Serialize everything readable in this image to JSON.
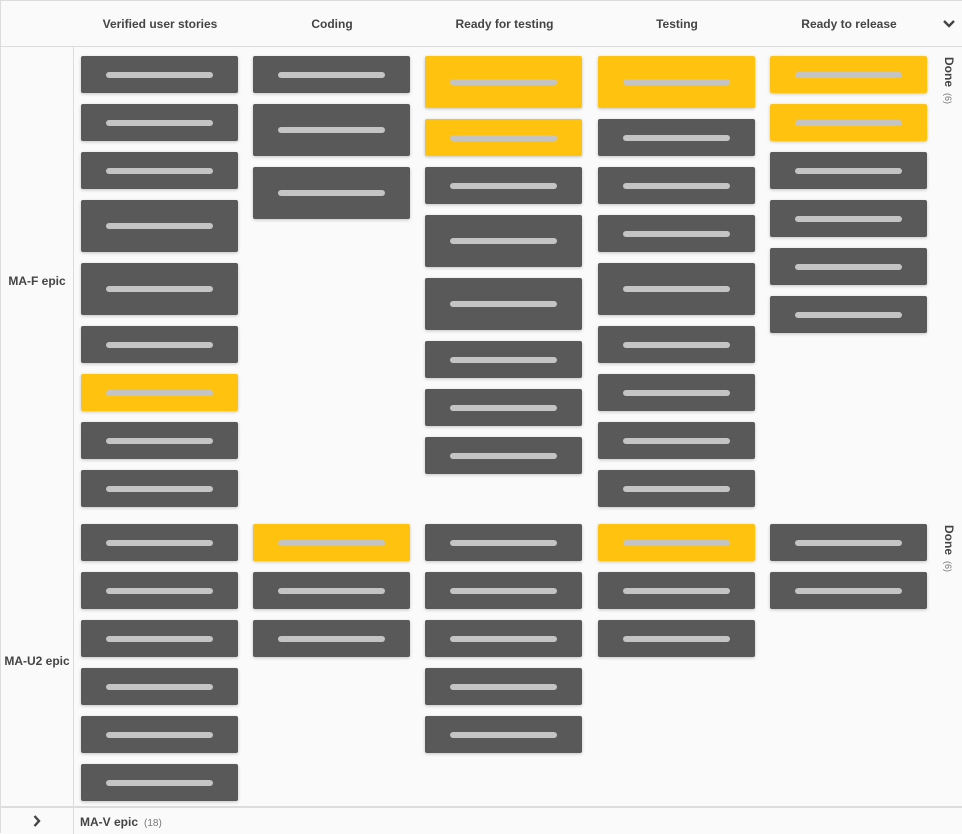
{
  "colors": {
    "card_default": "#595959",
    "card_highlight": "#ffc20e",
    "card_bar": "#c4c4c4"
  },
  "columns": [
    {
      "label": "Verified user stories"
    },
    {
      "label": "Coding"
    },
    {
      "label": "Ready for testing"
    },
    {
      "label": "Testing"
    },
    {
      "label": "Ready to release"
    }
  ],
  "collapse_columns_icon": "chevron-down-icon",
  "rows": [
    {
      "label": "MA-F epic",
      "done_label": "Done",
      "done_count": "(6)",
      "cells": [
        [
          {
            "size": "s",
            "color": "default"
          },
          {
            "size": "s",
            "color": "default"
          },
          {
            "size": "s",
            "color": "default"
          },
          {
            "size": "l",
            "color": "default"
          },
          {
            "size": "l",
            "color": "default"
          },
          {
            "size": "s",
            "color": "default"
          },
          {
            "size": "s",
            "color": "highlight"
          },
          {
            "size": "s",
            "color": "default"
          },
          {
            "size": "s",
            "color": "default"
          }
        ],
        [
          {
            "size": "s",
            "color": "default"
          },
          {
            "size": "l",
            "color": "default"
          },
          {
            "size": "l",
            "color": "default"
          }
        ],
        [
          {
            "size": "l",
            "color": "highlight"
          },
          {
            "size": "s",
            "color": "highlight"
          },
          {
            "size": "s",
            "color": "default"
          },
          {
            "size": "l",
            "color": "default"
          },
          {
            "size": "l",
            "color": "default"
          },
          {
            "size": "s",
            "color": "default"
          },
          {
            "size": "s",
            "color": "default"
          },
          {
            "size": "s",
            "color": "default"
          }
        ],
        [
          {
            "size": "l",
            "color": "highlight"
          },
          {
            "size": "s",
            "color": "default"
          },
          {
            "size": "s",
            "color": "default"
          },
          {
            "size": "s",
            "color": "default"
          },
          {
            "size": "l",
            "color": "default"
          },
          {
            "size": "s",
            "color": "default"
          },
          {
            "size": "s",
            "color": "default"
          },
          {
            "size": "s",
            "color": "default"
          },
          {
            "size": "s",
            "color": "default"
          }
        ],
        [
          {
            "size": "s",
            "color": "highlight"
          },
          {
            "size": "s",
            "color": "highlight"
          },
          {
            "size": "s",
            "color": "default"
          },
          {
            "size": "s",
            "color": "default"
          },
          {
            "size": "s",
            "color": "default"
          },
          {
            "size": "s",
            "color": "default"
          }
        ]
      ]
    },
    {
      "label": "MA-U2 epic",
      "done_label": "Done",
      "done_count": "(6)",
      "cells": [
        [
          {
            "size": "s",
            "color": "default"
          },
          {
            "size": "s",
            "color": "default"
          },
          {
            "size": "s",
            "color": "default"
          },
          {
            "size": "s",
            "color": "default"
          },
          {
            "size": "s",
            "color": "default"
          },
          {
            "size": "s",
            "color": "default"
          }
        ],
        [
          {
            "size": "s",
            "color": "highlight"
          },
          {
            "size": "s",
            "color": "default"
          },
          {
            "size": "s",
            "color": "default"
          }
        ],
        [
          {
            "size": "s",
            "color": "default"
          },
          {
            "size": "s",
            "color": "default"
          },
          {
            "size": "s",
            "color": "default"
          },
          {
            "size": "s",
            "color": "default"
          },
          {
            "size": "s",
            "color": "default"
          }
        ],
        [
          {
            "size": "s",
            "color": "highlight"
          },
          {
            "size": "s",
            "color": "default"
          },
          {
            "size": "s",
            "color": "default"
          }
        ],
        [
          {
            "size": "s",
            "color": "default"
          },
          {
            "size": "s",
            "color": "default"
          }
        ]
      ]
    }
  ],
  "collapsed_row": {
    "label": "MA-V epic",
    "count": "(18)",
    "expand_icon": "chevron-right-icon"
  }
}
